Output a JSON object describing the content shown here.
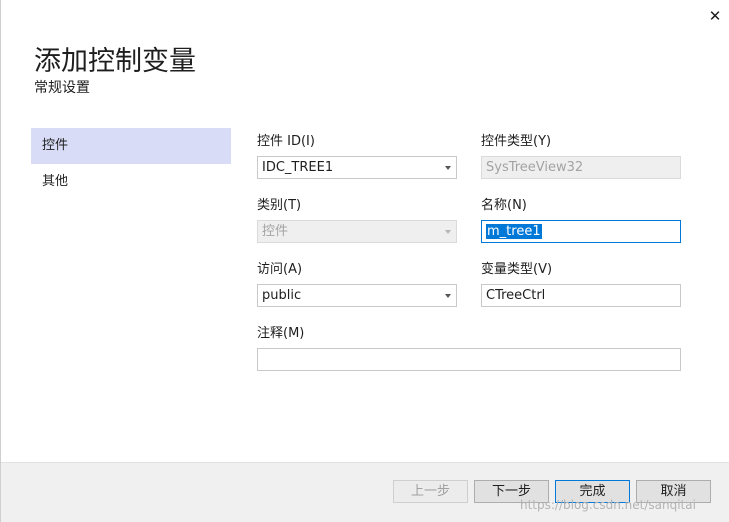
{
  "window": {
    "title": "添加控制变量",
    "subtitle": "常规设置",
    "close_glyph": "✕"
  },
  "nav": {
    "items": [
      {
        "label": "控件",
        "selected": true
      },
      {
        "label": "其他",
        "selected": false
      }
    ]
  },
  "form": {
    "control_id": {
      "label": "控件 ID(I)",
      "value": "IDC_TREE1"
    },
    "control_type": {
      "label": "控件类型(Y)",
      "value": "SysTreeView32"
    },
    "category": {
      "label": "类别(T)",
      "value": "控件"
    },
    "name": {
      "label": "名称(N)",
      "value": "m_tree1"
    },
    "access": {
      "label": "访问(A)",
      "value": "public"
    },
    "variable_type": {
      "label": "变量类型(V)",
      "value": "CTreeCtrl"
    },
    "comment": {
      "label": "注释(M)",
      "value": ""
    }
  },
  "footer": {
    "prev_label": "上一步",
    "next_label": "下一步",
    "finish_label": "完成",
    "cancel_label": "取消"
  },
  "watermark": "https://blog.csdn.net/sanqitai"
}
